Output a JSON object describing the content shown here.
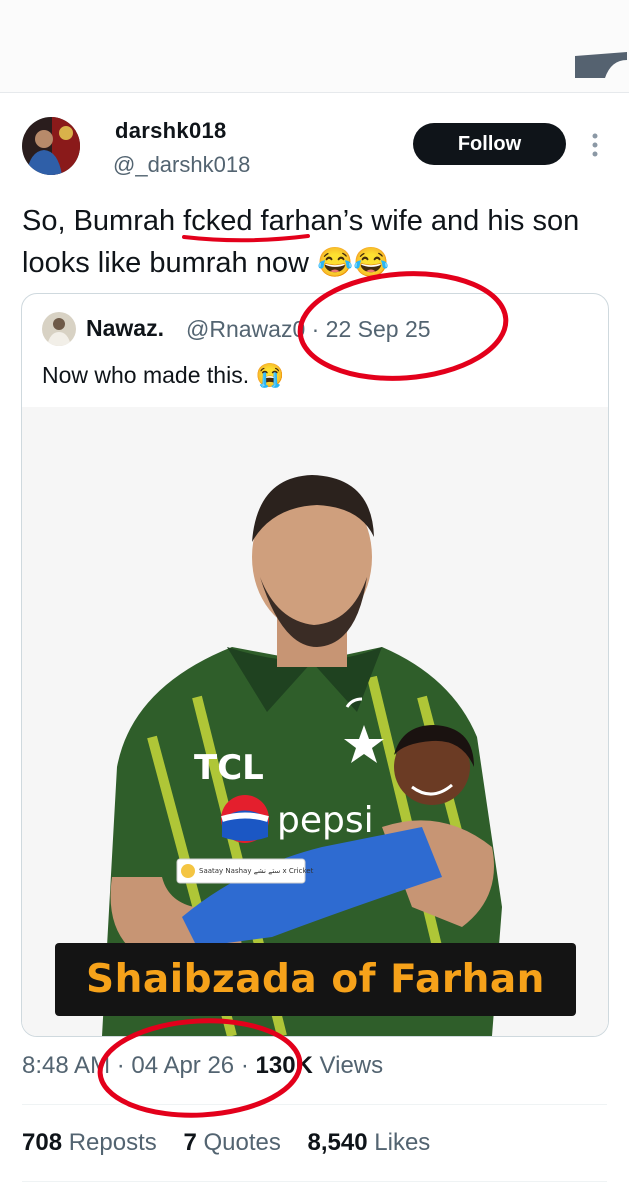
{
  "tweet": {
    "author": {
      "display_name": "darshk018",
      "handle": "@_darshk018"
    },
    "follow_label": "Follow",
    "text": "So, Bumrah fcked farhan’s wife and his son looks like bumrah now 😂😂",
    "quoted": {
      "author_name": "Nawaz.",
      "handle_and_date": "@Rnawaz0 · 22 Sep 25",
      "text": "Now who made this. 😭",
      "media": {
        "caption": "Shaibzada of Farhan",
        "jersey_sponsor": "TCL",
        "jersey_brand": "pepsi",
        "watermark": "Saatay Nashay ستے نشے x Cricket"
      }
    },
    "meta": {
      "time": "8:48 AM",
      "date": "04 Apr 26",
      "views_count": "130K",
      "views_label": "Views"
    },
    "stats": {
      "reposts_count": "708",
      "reposts_label": "Reposts",
      "quotes_count": "7",
      "quotes_label": "Quotes",
      "likes_count": "8,540",
      "likes_label": "Likes"
    }
  },
  "colors": {
    "text": "#0f1419",
    "secondary": "#536471",
    "annotation_red": "#e3001b",
    "caption_text": "#f6a21a",
    "jersey_green": "#2f5e2a"
  }
}
